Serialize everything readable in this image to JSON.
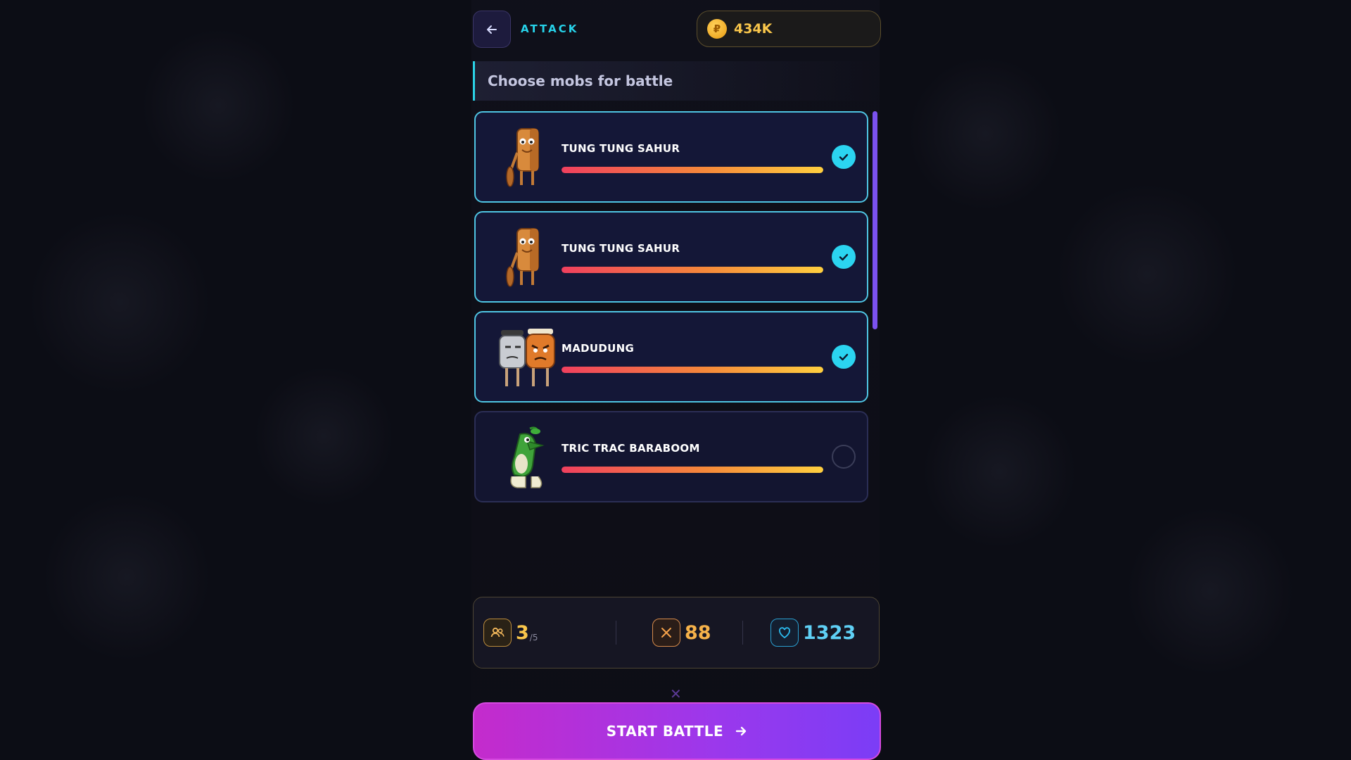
{
  "header": {
    "title": "ATTACK",
    "coins": "434K",
    "coin_symbol": "₽"
  },
  "section_title": "Choose mobs for battle",
  "mobs": [
    {
      "name": "TUNG TUNG SAHUR",
      "selected": true,
      "hp_fraction": 1.0,
      "avatar": "tung-tung-sahur"
    },
    {
      "name": "TUNG TUNG SAHUR",
      "selected": true,
      "hp_fraction": 1.0,
      "avatar": "tung-tung-sahur"
    },
    {
      "name": "MADUDUNG",
      "selected": true,
      "hp_fraction": 1.0,
      "avatar": "madudung"
    },
    {
      "name": "TRIC TRAC BARABOOM",
      "selected": false,
      "hp_fraction": 1.0,
      "avatar": "tric-trac-baraboom"
    }
  ],
  "stats": {
    "squad_count": "3",
    "squad_max": "/5",
    "attack": "88",
    "health": "1323"
  },
  "start_button": "START BATTLE",
  "colors": {
    "accent_cyan": "#27d3ea",
    "coin_gold": "#f9c64b",
    "attack_orange": "#f6a24a",
    "health_blue": "#2bbcf0",
    "start_gradient_from": "#c42bcc",
    "start_gradient_to": "#7b3df6"
  },
  "icons": {
    "back": "arrow-left-icon",
    "coin": "coin-icon",
    "check": "check-icon",
    "squad": "users-icon",
    "attack": "swords-icon",
    "health": "heart-icon",
    "start": "arrow-right-icon"
  }
}
